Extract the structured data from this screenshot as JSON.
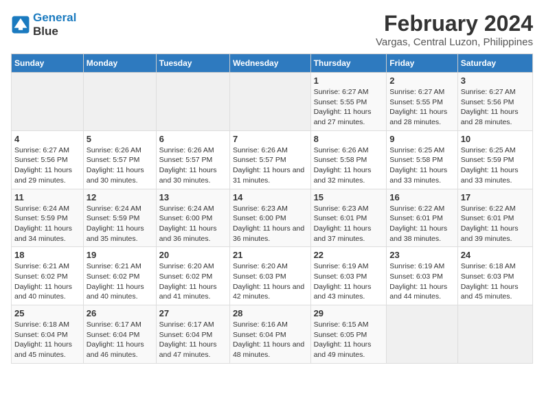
{
  "logo": {
    "line1": "General",
    "line2": "Blue"
  },
  "title": "February 2024",
  "subtitle": "Vargas, Central Luzon, Philippines",
  "weekdays": [
    "Sunday",
    "Monday",
    "Tuesday",
    "Wednesday",
    "Thursday",
    "Friday",
    "Saturday"
  ],
  "weeks": [
    [
      {
        "day": "",
        "info": ""
      },
      {
        "day": "",
        "info": ""
      },
      {
        "day": "",
        "info": ""
      },
      {
        "day": "",
        "info": ""
      },
      {
        "day": "1",
        "info": "Sunrise: 6:27 AM\nSunset: 5:55 PM\nDaylight: 11 hours and 27 minutes."
      },
      {
        "day": "2",
        "info": "Sunrise: 6:27 AM\nSunset: 5:55 PM\nDaylight: 11 hours and 28 minutes."
      },
      {
        "day": "3",
        "info": "Sunrise: 6:27 AM\nSunset: 5:56 PM\nDaylight: 11 hours and 28 minutes."
      }
    ],
    [
      {
        "day": "4",
        "info": "Sunrise: 6:27 AM\nSunset: 5:56 PM\nDaylight: 11 hours and 29 minutes."
      },
      {
        "day": "5",
        "info": "Sunrise: 6:26 AM\nSunset: 5:57 PM\nDaylight: 11 hours and 30 minutes."
      },
      {
        "day": "6",
        "info": "Sunrise: 6:26 AM\nSunset: 5:57 PM\nDaylight: 11 hours and 30 minutes."
      },
      {
        "day": "7",
        "info": "Sunrise: 6:26 AM\nSunset: 5:57 PM\nDaylight: 11 hours and 31 minutes."
      },
      {
        "day": "8",
        "info": "Sunrise: 6:26 AM\nSunset: 5:58 PM\nDaylight: 11 hours and 32 minutes."
      },
      {
        "day": "9",
        "info": "Sunrise: 6:25 AM\nSunset: 5:58 PM\nDaylight: 11 hours and 33 minutes."
      },
      {
        "day": "10",
        "info": "Sunrise: 6:25 AM\nSunset: 5:59 PM\nDaylight: 11 hours and 33 minutes."
      }
    ],
    [
      {
        "day": "11",
        "info": "Sunrise: 6:24 AM\nSunset: 5:59 PM\nDaylight: 11 hours and 34 minutes."
      },
      {
        "day": "12",
        "info": "Sunrise: 6:24 AM\nSunset: 5:59 PM\nDaylight: 11 hours and 35 minutes."
      },
      {
        "day": "13",
        "info": "Sunrise: 6:24 AM\nSunset: 6:00 PM\nDaylight: 11 hours and 36 minutes."
      },
      {
        "day": "14",
        "info": "Sunrise: 6:23 AM\nSunset: 6:00 PM\nDaylight: 11 hours and 36 minutes."
      },
      {
        "day": "15",
        "info": "Sunrise: 6:23 AM\nSunset: 6:01 PM\nDaylight: 11 hours and 37 minutes."
      },
      {
        "day": "16",
        "info": "Sunrise: 6:22 AM\nSunset: 6:01 PM\nDaylight: 11 hours and 38 minutes."
      },
      {
        "day": "17",
        "info": "Sunrise: 6:22 AM\nSunset: 6:01 PM\nDaylight: 11 hours and 39 minutes."
      }
    ],
    [
      {
        "day": "18",
        "info": "Sunrise: 6:21 AM\nSunset: 6:02 PM\nDaylight: 11 hours and 40 minutes."
      },
      {
        "day": "19",
        "info": "Sunrise: 6:21 AM\nSunset: 6:02 PM\nDaylight: 11 hours and 40 minutes."
      },
      {
        "day": "20",
        "info": "Sunrise: 6:20 AM\nSunset: 6:02 PM\nDaylight: 11 hours and 41 minutes."
      },
      {
        "day": "21",
        "info": "Sunrise: 6:20 AM\nSunset: 6:03 PM\nDaylight: 11 hours and 42 minutes."
      },
      {
        "day": "22",
        "info": "Sunrise: 6:19 AM\nSunset: 6:03 PM\nDaylight: 11 hours and 43 minutes."
      },
      {
        "day": "23",
        "info": "Sunrise: 6:19 AM\nSunset: 6:03 PM\nDaylight: 11 hours and 44 minutes."
      },
      {
        "day": "24",
        "info": "Sunrise: 6:18 AM\nSunset: 6:03 PM\nDaylight: 11 hours and 45 minutes."
      }
    ],
    [
      {
        "day": "25",
        "info": "Sunrise: 6:18 AM\nSunset: 6:04 PM\nDaylight: 11 hours and 45 minutes."
      },
      {
        "day": "26",
        "info": "Sunrise: 6:17 AM\nSunset: 6:04 PM\nDaylight: 11 hours and 46 minutes."
      },
      {
        "day": "27",
        "info": "Sunrise: 6:17 AM\nSunset: 6:04 PM\nDaylight: 11 hours and 47 minutes."
      },
      {
        "day": "28",
        "info": "Sunrise: 6:16 AM\nSunset: 6:04 PM\nDaylight: 11 hours and 48 minutes."
      },
      {
        "day": "29",
        "info": "Sunrise: 6:15 AM\nSunset: 6:05 PM\nDaylight: 11 hours and 49 minutes."
      },
      {
        "day": "",
        "info": ""
      },
      {
        "day": "",
        "info": ""
      }
    ]
  ]
}
